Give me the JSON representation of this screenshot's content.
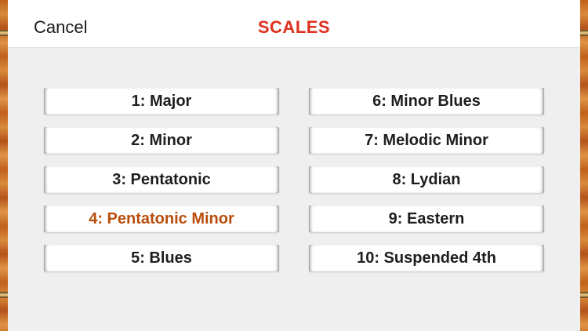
{
  "nav": {
    "cancel_label": "Cancel",
    "title": "SCALES"
  },
  "colors": {
    "title": "#e0301e",
    "selected": "#b84d0c"
  },
  "scales_left": [
    {
      "label": "1: Major",
      "selected": false
    },
    {
      "label": "2: Minor",
      "selected": false
    },
    {
      "label": "3: Pentatonic",
      "selected": false
    },
    {
      "label": "4: Pentatonic Minor",
      "selected": true
    },
    {
      "label": "5: Blues",
      "selected": false
    }
  ],
  "scales_right": [
    {
      "label": "6: Minor Blues",
      "selected": false
    },
    {
      "label": "7: Melodic Minor",
      "selected": false
    },
    {
      "label": "8: Lydian",
      "selected": false
    },
    {
      "label": "9: Eastern",
      "selected": false
    },
    {
      "label": "10: Suspended 4th",
      "selected": false
    }
  ]
}
